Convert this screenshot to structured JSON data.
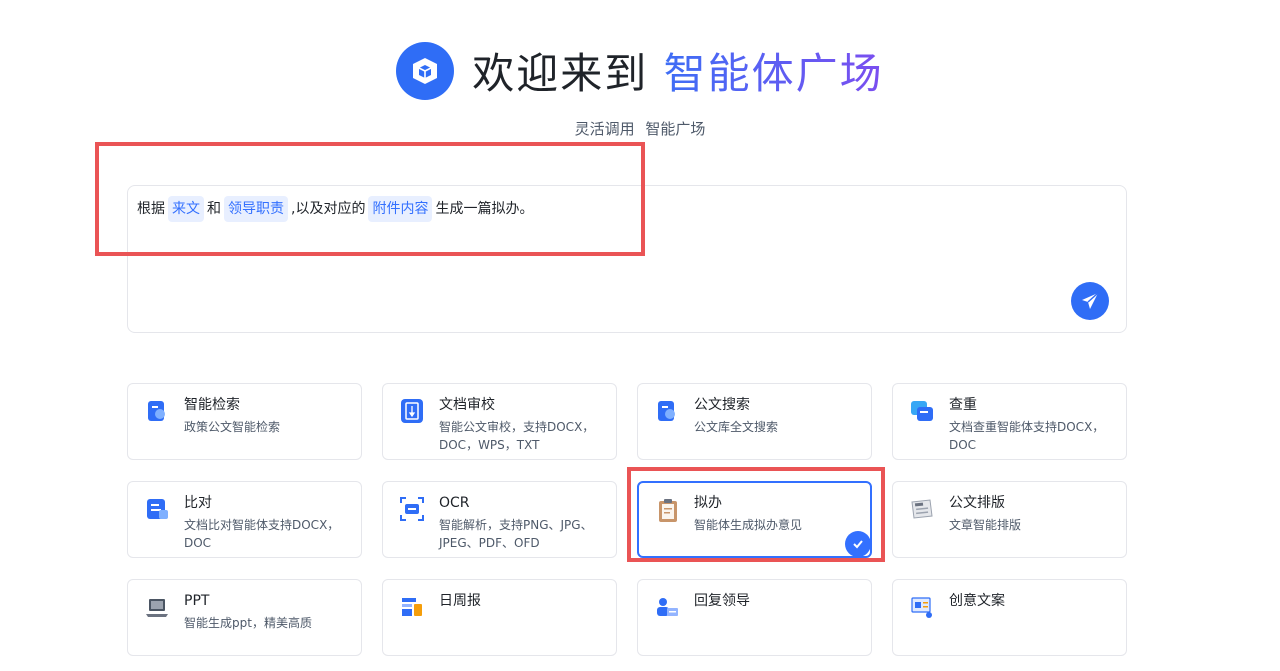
{
  "header": {
    "title_prefix": "欢迎来到",
    "title_highlight": "智能体广场",
    "subtitle": "灵活调用 智能广场"
  },
  "prompt": {
    "parts": [
      "根据",
      "来文",
      "和",
      "领导职责",
      ",以及对应的",
      "附件内容",
      "生成一篇拟办。"
    ]
  },
  "colors": {
    "accent": "#2f6df6",
    "annotation": "#ea5455",
    "chip_bg": "#e8efff"
  },
  "cards": [
    {
      "name": "智能检索",
      "desc": "政策公文智能检索",
      "icon": "search-doc-icon"
    },
    {
      "name": "文档审校",
      "desc": "智能公文审校，支持DOCX，DOC，WPS，TXT",
      "icon": "proofread-icon"
    },
    {
      "name": "公文搜索",
      "desc": "公文库全文搜索",
      "icon": "doc-search-icon"
    },
    {
      "name": "查重",
      "desc": "文档查重智能体支持DOCX，DOC",
      "icon": "duplicate-check-icon"
    },
    {
      "name": "比对",
      "desc": "文档比对智能体支持DOCX，DOC",
      "icon": "compare-icon"
    },
    {
      "name": "OCR",
      "desc": "智能解析，支持PNG、JPG、JPEG、PDF、OFD",
      "icon": "ocr-icon"
    },
    {
      "name": "拟办",
      "desc": "智能体生成拟办意见",
      "icon": "clipboard-icon",
      "selected": true
    },
    {
      "name": "公文排版",
      "desc": "文章智能排版",
      "icon": "newspaper-icon"
    },
    {
      "name": "PPT",
      "desc": "智能生成ppt，精美高质",
      "icon": "laptop-icon"
    },
    {
      "name": "日周报",
      "desc": "",
      "icon": "report-icon"
    },
    {
      "name": "回复领导",
      "desc": "",
      "icon": "reply-icon"
    },
    {
      "name": "创意文案",
      "desc": "",
      "icon": "creative-icon"
    }
  ]
}
